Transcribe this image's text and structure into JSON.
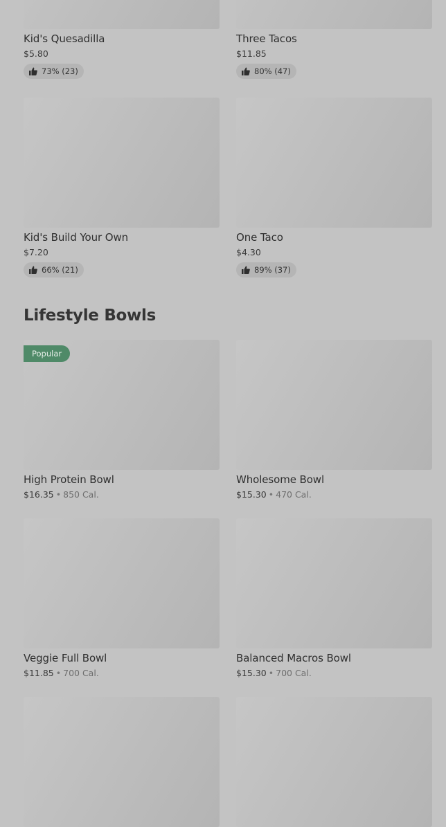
{
  "kids_items": [
    {
      "name": "Kid's Quesadilla",
      "price": "$5.80",
      "rating": "73% (23)"
    },
    {
      "name": "Three Tacos",
      "price": "$11.85",
      "rating": "80% (47)"
    },
    {
      "name": "Kid's Build Your Own",
      "price": "$7.20",
      "rating": "66% (21)"
    },
    {
      "name": "One Taco",
      "price": "$4.30",
      "rating": "89% (37)"
    }
  ],
  "lifestyle": {
    "title": "Lifestyle Bowls",
    "badge": "Popular",
    "separator": "•",
    "items": [
      {
        "name": "High Protein Bowl",
        "price": "$16.35",
        "calories": "850 Cal."
      },
      {
        "name": "Wholesome Bowl",
        "price": "$15.30",
        "calories": "470 Cal."
      },
      {
        "name": "Veggie Full Bowl",
        "price": "$11.85",
        "calories": "700 Cal."
      },
      {
        "name": "Balanced Macros Bowl",
        "price": "$15.30",
        "calories": "700 Cal."
      }
    ]
  },
  "icons": {
    "rating": "thumbs-up-icon"
  }
}
